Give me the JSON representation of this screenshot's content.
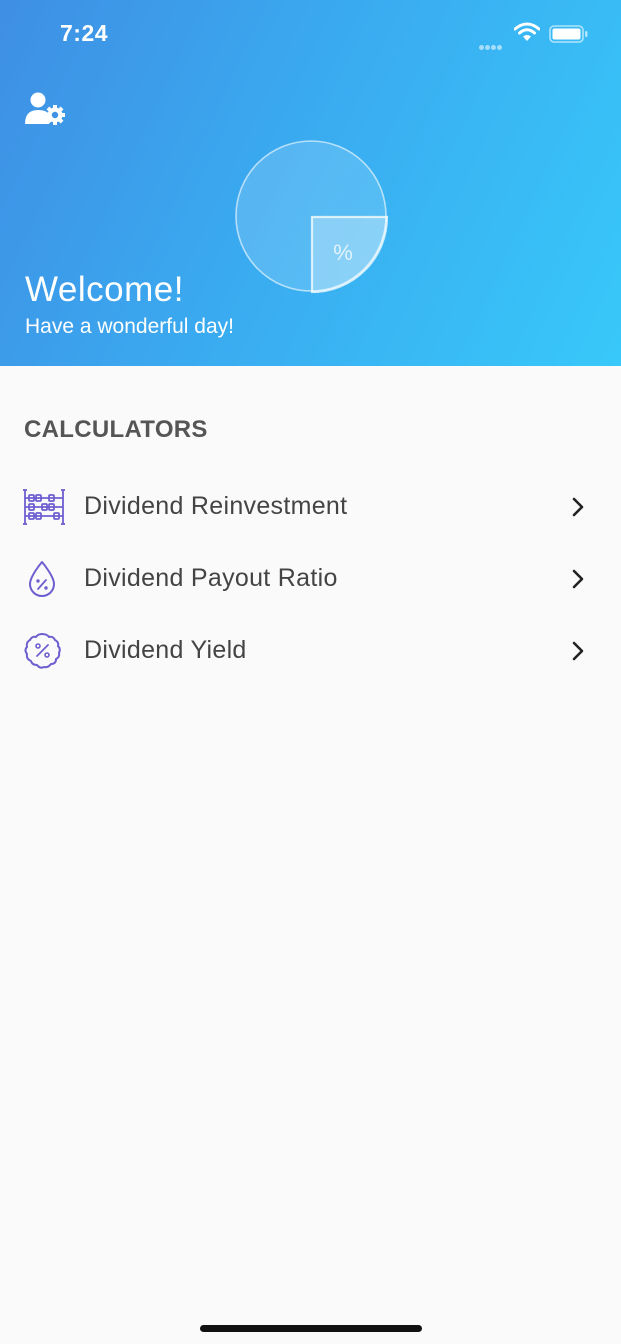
{
  "status_bar": {
    "time": "7:24"
  },
  "header": {
    "account_icon": "user-gear-icon",
    "hero_icon": "pie-percent-icon",
    "hero_symbol": "%",
    "title": "Welcome!",
    "subtitle": "Have a wonderful day!"
  },
  "section": {
    "title": "CALCULATORS"
  },
  "calculators": [
    {
      "label": "Dividend Reinvestment",
      "icon": "abacus-icon"
    },
    {
      "label": "Dividend Payout Ratio",
      "icon": "drop-percent-icon"
    },
    {
      "label": "Dividend Yield",
      "icon": "badge-percent-icon"
    }
  ],
  "colors": {
    "header_gradient_start": "#3f8fe4",
    "header_gradient_end": "#38c8f9",
    "icon_accent": "#6e5fd1",
    "background": "#fafafa",
    "text": "#444444"
  }
}
